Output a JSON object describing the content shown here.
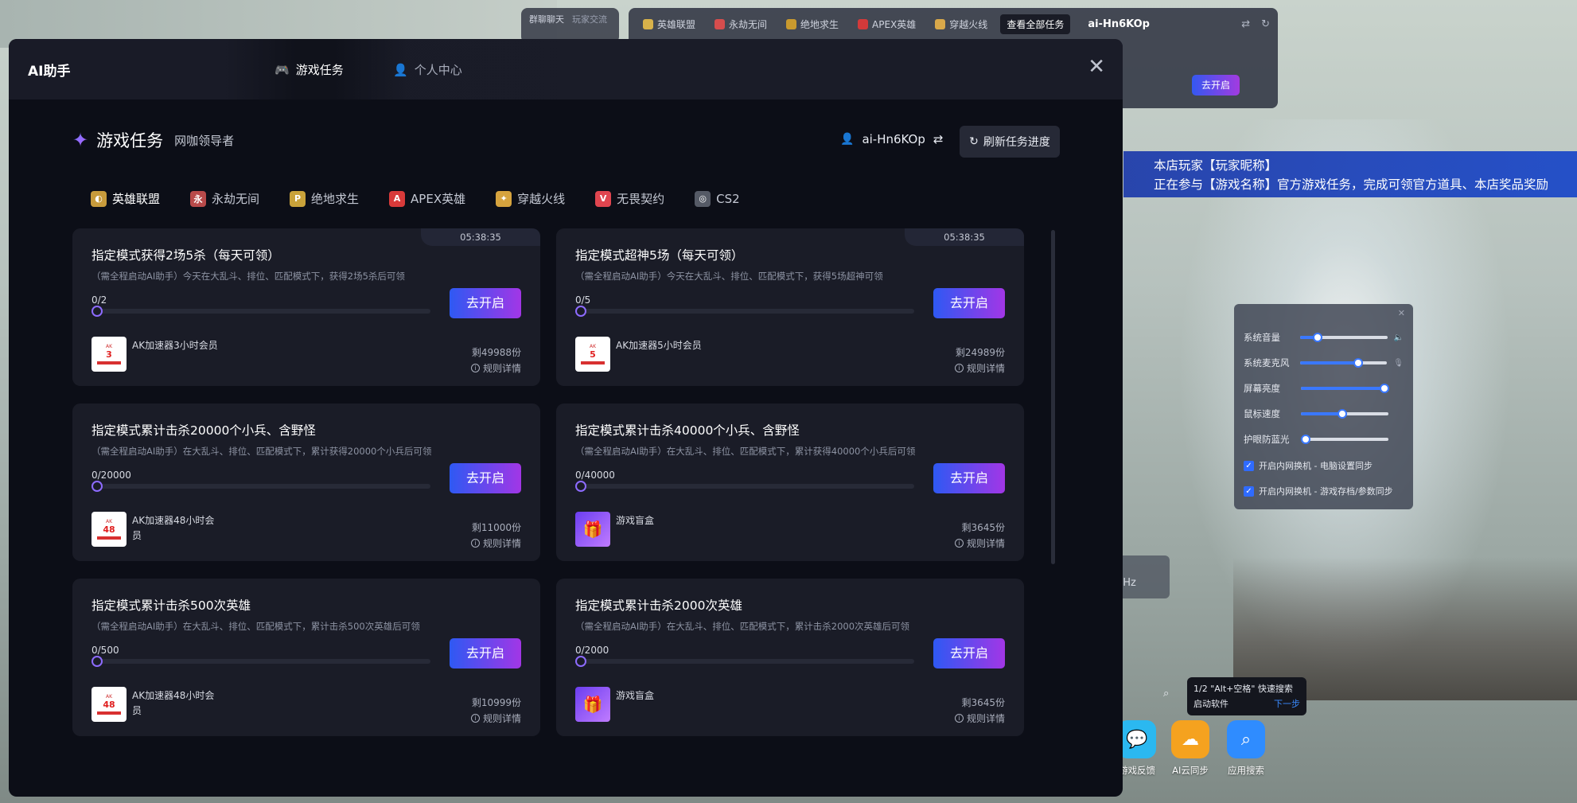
{
  "top_bar": {
    "chat_tabs": [
      "群聊聊天",
      "玩家交流"
    ],
    "tasks": [
      {
        "label": "英雄联盟",
        "color": "#d8b24a"
      },
      {
        "label": "永劫无间",
        "color": "#d64d4d"
      },
      {
        "label": "绝地求生",
        "color": "#c99a2e"
      },
      {
        "label": "APEX英雄",
        "color": "#d33a3a"
      },
      {
        "label": "穿越火线",
        "color": "#d8a84a"
      }
    ],
    "view_all": "查看全部任务",
    "user": "ai-Hn6KOp",
    "go_label": "去开启"
  },
  "banner": {
    "line1": "本店玩家【玩家昵称】",
    "line2": "正在参与【游戏名称】官方游戏任务，完成可领官方道具、本店奖品奖励"
  },
  "system_panel": {
    "sliders": [
      {
        "label": "系统音量",
        "value": 0.2
      },
      {
        "label": "系统麦克风",
        "value": 0.67
      },
      {
        "label": "屏幕亮度",
        "value": 0.95
      },
      {
        "label": "鼠标速度",
        "value": 0.47
      },
      {
        "label": "护眼防蓝光",
        "value": 0.05
      }
    ],
    "checks": [
      "开启内网换机 - 电脑设置同步",
      "开启内网换机 - 游戏存档/参数同步"
    ]
  },
  "dock": {
    "mhz": "MHz",
    "tooltip_line1": "1/2 \"Alt+空格\" 快速搜索",
    "tooltip_line2": "启动软件",
    "tooltip_next": "下一步",
    "apps": [
      {
        "label": "游戏反馈",
        "color": "#2bb8f0"
      },
      {
        "label": "AI云同步",
        "color": "#f5a21f"
      },
      {
        "label": "应用搜索",
        "color": "#2f8cff"
      }
    ]
  },
  "dialog": {
    "title": "AI助手",
    "tabs": [
      "游戏任务",
      "个人中心"
    ],
    "section_title": "游戏任务",
    "section_sub": "网咖领导者",
    "account": "ai-Hn6KOp",
    "refresh": "刷新任务进度",
    "games": [
      {
        "label": "英雄联盟",
        "color": "#c89b3c",
        "glyph": "◐"
      },
      {
        "label": "永劫无间",
        "color": "#b84a4a",
        "glyph": "永"
      },
      {
        "label": "绝地求生",
        "color": "#c9a23a",
        "glyph": "P"
      },
      {
        "label": "APEX英雄",
        "color": "#d83a3a",
        "glyph": "A"
      },
      {
        "label": "穿越火线",
        "color": "#d6a33e",
        "glyph": "✦"
      },
      {
        "label": "无畏契约",
        "color": "#e0454f",
        "glyph": "V"
      },
      {
        "label": "CS2",
        "color": "#555a66",
        "glyph": "◎"
      }
    ],
    "go_label": "去开启",
    "rules_label": "规则详情",
    "tasks": [
      {
        "title": "指定模式获得2场5杀（每天可领）",
        "desc": "（需全程启动AI助手）今天在大乱斗、排位、匹配模式下，获得2场5杀后可领",
        "timer": "05:38:35",
        "progress": "0/2",
        "reward": "AK加速器3小时会员",
        "reward_type": "card",
        "reward_num": "3",
        "remain": "剩49988份"
      },
      {
        "title": "指定模式超神5场（每天可领）",
        "desc": "（需全程启动AI助手）今天在大乱斗、排位、匹配模式下，获得5场超神可领",
        "timer": "05:38:35",
        "progress": "0/5",
        "reward": "AK加速器5小时会员",
        "reward_type": "card",
        "reward_num": "5",
        "remain": "剩24989份"
      },
      {
        "title": "指定模式累计击杀20000个小兵、含野怪",
        "desc": "（需全程启动AI助手）在大乱斗、排位、匹配模式下，累计获得20000个小兵后可领",
        "timer": "",
        "progress": "0/20000",
        "reward": "AK加速器48小时会员",
        "reward_type": "card",
        "reward_num": "48",
        "remain": "剩11000份"
      },
      {
        "title": "指定模式累计击杀40000个小兵、含野怪",
        "desc": "（需全程启动AI助手）在大乱斗、排位、匹配模式下，累计获得40000个小兵后可领",
        "timer": "",
        "progress": "0/40000",
        "reward": "游戏盲盒",
        "reward_type": "box",
        "reward_num": "",
        "remain": "剩3645份"
      },
      {
        "title": "指定模式累计击杀500次英雄",
        "desc": "（需全程启动AI助手）在大乱斗、排位、匹配模式下，累计击杀500次英雄后可领",
        "timer": "",
        "progress": "0/500",
        "reward": "AK加速器48小时会员",
        "reward_type": "card",
        "reward_num": "48",
        "remain": "剩10999份"
      },
      {
        "title": "指定模式累计击杀2000次英雄",
        "desc": "（需全程启动AI助手）在大乱斗、排位、匹配模式下，累计击杀2000次英雄后可领",
        "timer": "",
        "progress": "0/2000",
        "reward": "游戏盲盒",
        "reward_type": "box",
        "reward_num": "",
        "remain": "剩3645份"
      }
    ]
  }
}
